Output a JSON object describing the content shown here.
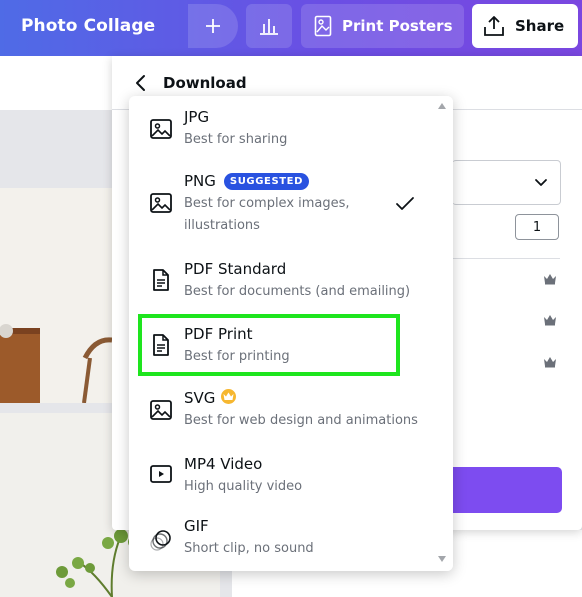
{
  "topbar": {
    "app_title": "Photo Collage",
    "print_posters_label": "Print Posters",
    "share_label": "Share"
  },
  "download_panel": {
    "title": "Download",
    "quantity": "1"
  },
  "file_types": [
    {
      "name": "JPG",
      "description": "Best for sharing",
      "icon": "image-icon"
    },
    {
      "name": "PNG",
      "badge": "SUGGESTED",
      "description": "Best for complex images, illustrations",
      "icon": "image-icon",
      "selected": true
    },
    {
      "name": "PDF Standard",
      "description": "Best for documents (and emailing)",
      "icon": "document-icon"
    },
    {
      "name": "PDF Print",
      "description": "Best for printing",
      "icon": "document-icon",
      "highlighted": true
    },
    {
      "name": "SVG",
      "description": "Best for web design and animations",
      "icon": "image-icon",
      "pro": true
    },
    {
      "name": "MP4 Video",
      "description": "High quality video",
      "icon": "video-icon"
    },
    {
      "name": "GIF",
      "description": "Short clip, no sound",
      "icon": "gif-icon"
    }
  ],
  "colors": {
    "accent": "#7d4cf0",
    "badge": "#2952e0",
    "highlight": "#1ee51e",
    "pro": "#f6b730"
  }
}
